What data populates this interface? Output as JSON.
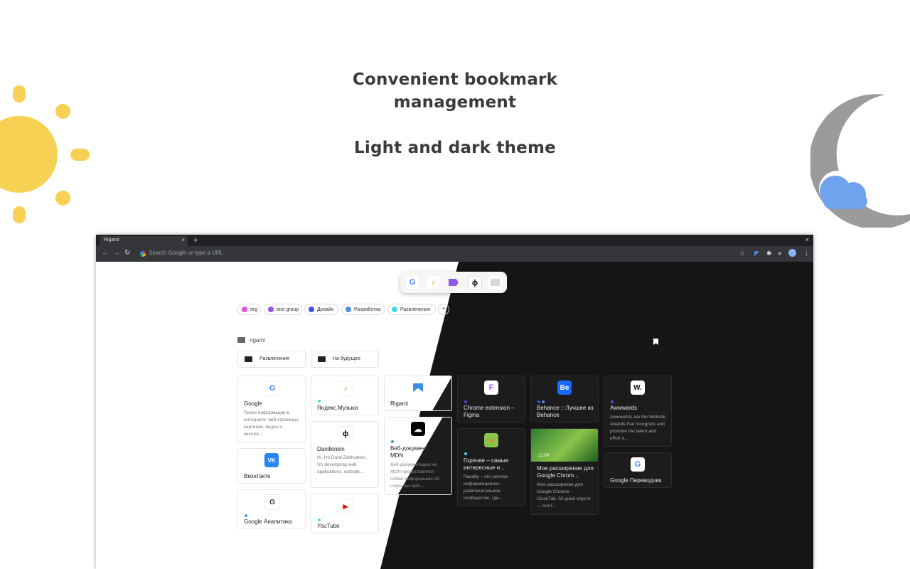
{
  "headline": {
    "line1": "Convenient bookmark",
    "line2": "management",
    "line3": "Light and dark theme"
  },
  "colors": {
    "sun": "#f6d154",
    "moon": "#9b9b9b",
    "cloud": "#6fa3ee",
    "dark_theme": "#151515"
  },
  "browser": {
    "tab_title": "Rigami",
    "tab_close": "×",
    "new_tab": "+",
    "window_close": "×",
    "omnibox_placeholder": "Search Google or type a URL",
    "nav": {
      "back": "←",
      "forward": "→",
      "reload": "↻"
    },
    "toolbar_icons": [
      "star-icon",
      "rigami-extension-icon",
      "puzzle-icon",
      "media-icon",
      "profile-avatar",
      "kebab-menu-icon"
    ]
  },
  "quickbar": {
    "items": [
      {
        "icon": "google-icon",
        "glyph": "G"
      },
      {
        "icon": "yandex-music-icon",
        "glyph": "♪"
      },
      {
        "icon": "tag-icon",
        "glyph": ""
      },
      {
        "icon": "phi-icon",
        "glyph": "ϕ"
      },
      {
        "icon": "folder-icon",
        "glyph": ""
      }
    ]
  },
  "groups": {
    "items": [
      {
        "label": "erg",
        "color": "#e24ee6"
      },
      {
        "label": "test group",
        "color": "#9b4fe0"
      },
      {
        "label": "Дизайн",
        "color": "#4652d9"
      },
      {
        "label": "Разработка",
        "color": "#4a90e2"
      },
      {
        "label": "Развлечения",
        "color": "#46d9e6"
      }
    ],
    "add": "+"
  },
  "folder": {
    "name": "rigami",
    "subfolders": [
      "Развлечения",
      "На будущее"
    ]
  },
  "cards": [
    {
      "title": "Google",
      "desc": "Поиск информации в интернете: веб страницы, картинки, видео и многое...",
      "icon": "google-icon",
      "glyph": "G"
    },
    {
      "title": "Вконтакте",
      "desc": "",
      "icon": "vk-icon",
      "glyph": "VK"
    },
    {
      "title": "Google Аналитика",
      "desc": "",
      "icon": "google-analytics-icon",
      "glyph": "G"
    },
    {
      "title": "Яндекс.Музыка",
      "desc": "",
      "icon": "yandex-music-icon",
      "glyph": "♪"
    },
    {
      "title": "Danilkinkin",
      "desc": "Hi, I'm Danil Zakhvatkin, I'm developing web applications, website...",
      "icon": "phi-icon",
      "glyph": "ϕ"
    },
    {
      "title": "YouTube",
      "desc": "",
      "icon": "youtube-icon",
      "glyph": "▶"
    },
    {
      "title": "Rigami",
      "desc": "",
      "icon": "rigami-icon",
      "glyph": ""
    },
    {
      "title": "Веб-документация MDN",
      "desc": "Веб-документация на MDN предоставляет собой информацию об открытых веб-...",
      "icon": "mdn-icon",
      "glyph": "☁"
    },
    {
      "title": "Chrome extension – Figma",
      "desc": "",
      "icon": "figma-icon",
      "glyph": "F"
    },
    {
      "title": "Горячее – самые интересные и...",
      "desc": "Пикабу – это уютное информационно-развлекательное сообщество, где...",
      "icon": "pikabu-icon",
      "glyph": "◕"
    },
    {
      "title": "Behance :: Лучшее из Behance",
      "desc": "",
      "icon": "behance-icon",
      "glyph": "Be"
    },
    {
      "title": "Мое расширение для Google Chrom...",
      "desc": "Мое расширение для Google Chrome - ClockTab. 50 дней спустя — пост...",
      "icon": "clocktab-preview",
      "preview_time": "21:09"
    },
    {
      "title": "Awwwards",
      "desc": "Awwwards are the Website Awards that recognize and promote the talent and effort o...",
      "icon": "awwwards-icon",
      "glyph": "W."
    },
    {
      "title": "Google Переводчик",
      "desc": "",
      "icon": "google-translate-icon",
      "glyph": "G"
    }
  ]
}
